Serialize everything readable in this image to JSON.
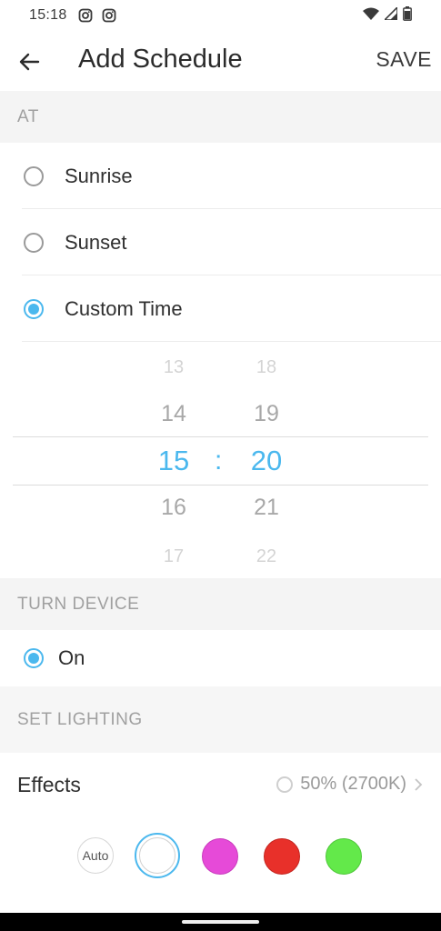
{
  "status_bar": {
    "time": "15:18"
  },
  "header": {
    "title": "Add Schedule",
    "save_label": "SAVE"
  },
  "sections": {
    "at": "AT",
    "turn_device": "TURN DEVICE",
    "set_lighting": "SET LIGHTING"
  },
  "at_options": [
    {
      "label": "Sunrise",
      "selected": false
    },
    {
      "label": "Sunset",
      "selected": false
    },
    {
      "label": "Custom Time",
      "selected": true
    }
  ],
  "time_picker": {
    "hours": [
      "13",
      "14",
      "15",
      "16",
      "17"
    ],
    "minutes": [
      "18",
      "19",
      "20",
      "21",
      "22"
    ],
    "separator": ":",
    "selected_hour": "15",
    "selected_minute": "20"
  },
  "turn_device": {
    "label": "On",
    "selected": true
  },
  "effects": {
    "label": "Effects",
    "value": "50% (2700K)"
  },
  "swatches": {
    "auto_label": "Auto",
    "colors": [
      "#ffffff",
      "#e64ad8",
      "#e8302a",
      "#63e94a"
    ],
    "selected_color": "#ffffff"
  },
  "theme": {
    "accent": "#4bb8ee"
  }
}
